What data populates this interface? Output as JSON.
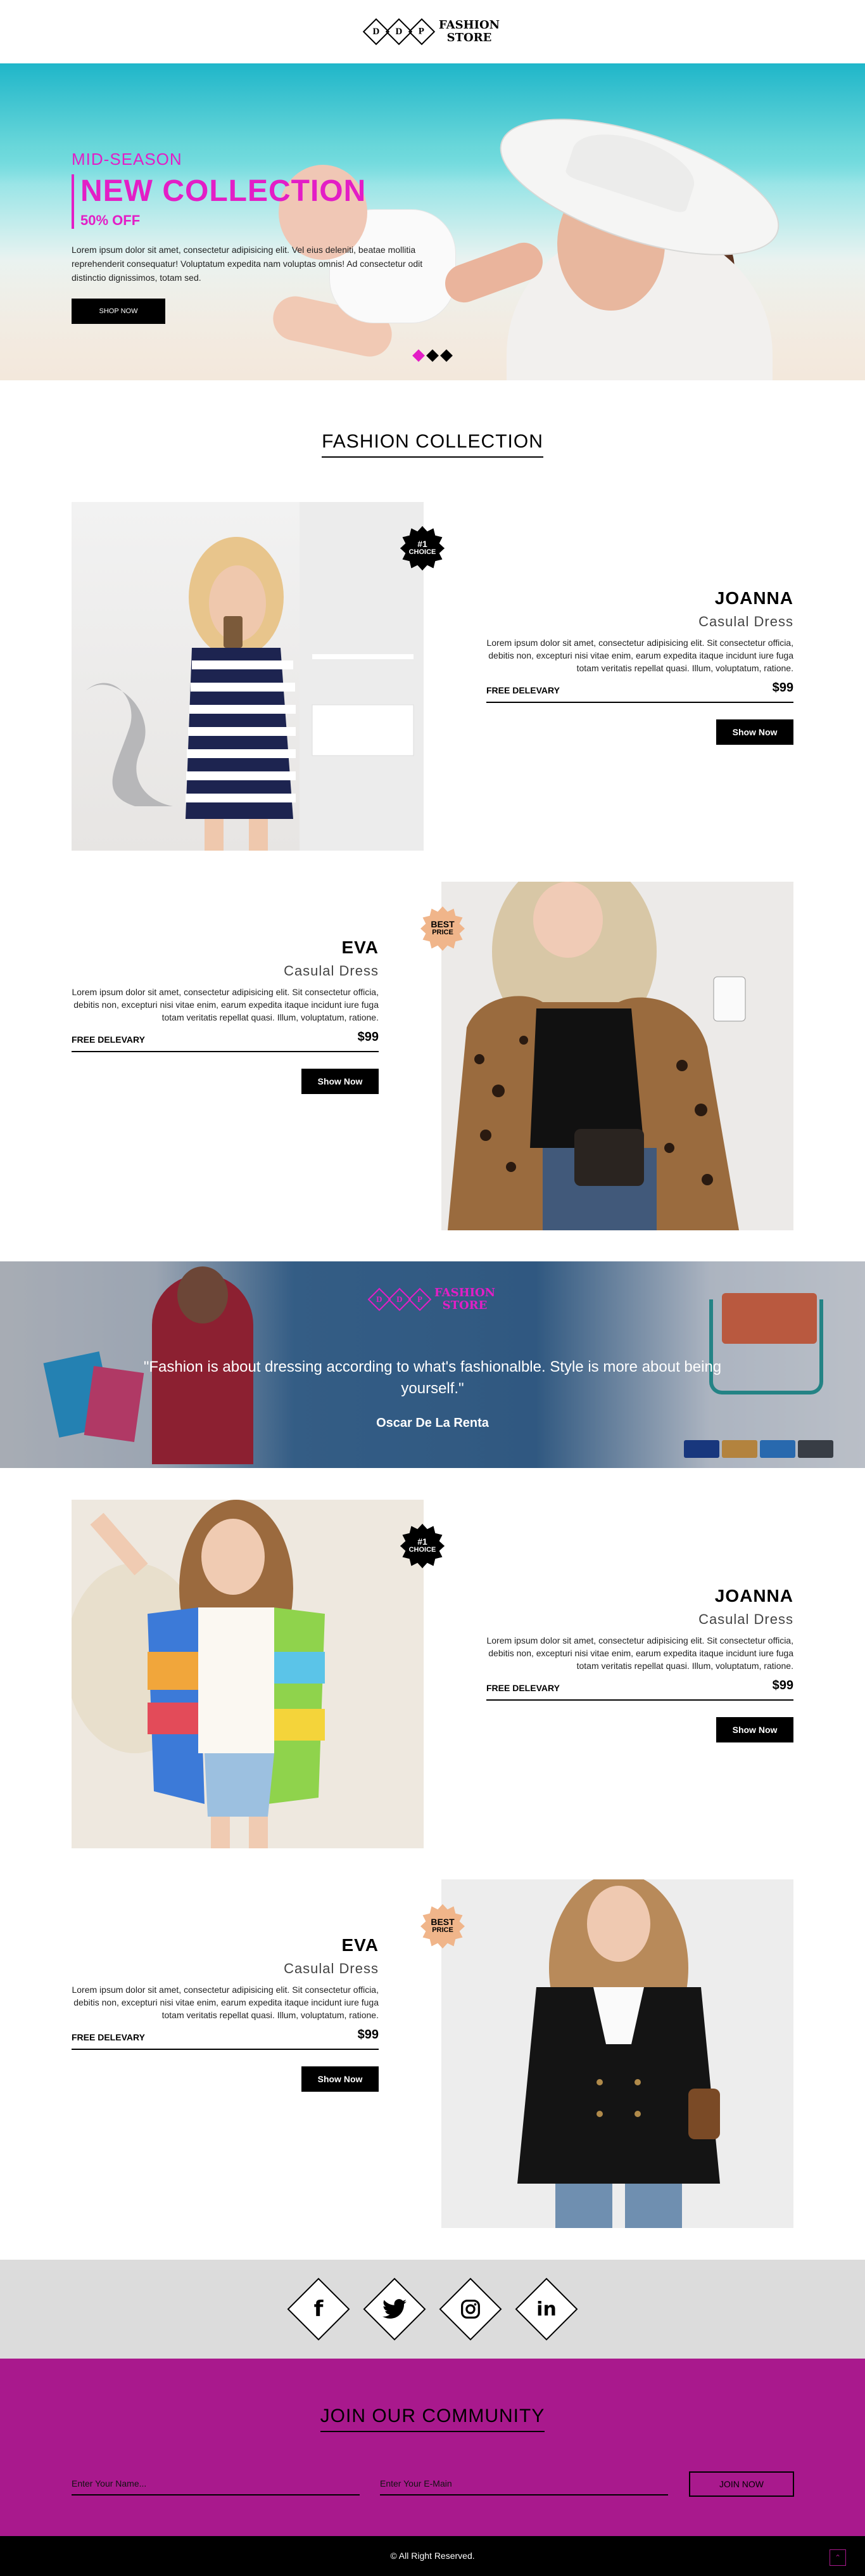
{
  "header": {
    "logo_mark": [
      "D",
      "D",
      "P"
    ],
    "logo_line1": "FASHION",
    "logo_line2": "STORE"
  },
  "hero": {
    "kicker": "MID-SEASON",
    "title": "NEW COLLECTION",
    "offer": "50% OFF",
    "description": "Lorem ipsum dolor sit amet, consectetur adipisicing elit. Vel eius deleniti, beatae mollitia reprehenderit consequatur! Voluptatum expedita nam voluptas omnis! Ad consectetur odit distinctio dignissimos, totam sed.",
    "button": "SHOP NOW"
  },
  "collection_title": "FASHION COLLECTION",
  "products": [
    {
      "name": "JOANNA",
      "type": "Casulal Dress",
      "badge_line1": "#1",
      "badge_line2": "CHOICE",
      "description": "Lorem ipsum dolor sit amet, consectetur adipisicing elit. Sit consectetur officia, debitis non, excepturi nisi vitae enim, earum expedita itaque incidunt iure fuga totam veritatis repellat quasi. Illum, voluptatum, ratione.",
      "shipping": "FREE DELEVARY",
      "price": "$99",
      "button": "Show Now"
    },
    {
      "name": "EVA",
      "type": "Casulal Dress",
      "badge_line1": "BEST",
      "badge_line2": "PRICE",
      "description": "Lorem ipsum dolor sit amet, consectetur adipisicing elit. Sit consectetur officia, debitis non, excepturi nisi vitae enim, earum expedita itaque incidunt iure fuga totam veritatis repellat quasi. Illum, voluptatum, ratione.",
      "shipping": "FREE DELEVARY",
      "price": "$99",
      "button": "Show Now"
    },
    {
      "name": "JOANNA",
      "type": "Casulal Dress",
      "badge_line1": "#1",
      "badge_line2": "CHOICE",
      "description": "Lorem ipsum dolor sit amet, consectetur adipisicing elit. Sit consectetur officia, debitis non, excepturi nisi vitae enim, earum expedita itaque incidunt iure fuga totam veritatis repellat quasi. Illum, voluptatum, ratione.",
      "shipping": "FREE DELEVARY",
      "price": "$99",
      "button": "Show Now"
    },
    {
      "name": "EVA",
      "type": "Casulal Dress",
      "badge_line1": "BEST",
      "badge_line2": "PRICE",
      "description": "Lorem ipsum dolor sit amet, consectetur adipisicing elit. Sit consectetur officia, debitis non, excepturi nisi vitae enim, earum expedita itaque incidunt iure fuga totam veritatis repellat quasi. Illum, voluptatum, ratione.",
      "shipping": "FREE DELEVARY",
      "price": "$99",
      "button": "Show Now"
    }
  ],
  "quote": {
    "logo_line1": "FASHION",
    "logo_line2": "STORE",
    "text": "\"Fashion is about dressing according to what's fashionalble. Style is more about being yourself.\"",
    "author": "Oscar De La Renta"
  },
  "social": {
    "icons": [
      "facebook-icon",
      "twitter-icon",
      "instagram-icon",
      "linkedin-icon"
    ]
  },
  "community": {
    "title": "JOIN OUR COMMUNITY",
    "name_placeholder": "Enter Your Name...",
    "email_placeholder": "Enter Your E-Main",
    "button": "JOIN NOW"
  },
  "footer": {
    "copyright": "© All Right Reserved."
  },
  "colors": {
    "accent": "#e31ec6",
    "community_bg": "#a9198d",
    "social_bg": "#dcdcdc"
  }
}
